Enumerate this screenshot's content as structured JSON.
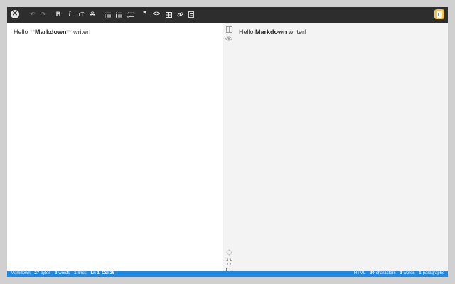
{
  "toolbar": {
    "buttons": [
      {
        "id": "undo",
        "glyph": "↶",
        "icon": "undo-icon",
        "enabled": false
      },
      {
        "id": "redo",
        "glyph": "↷",
        "icon": "redo-icon",
        "enabled": false
      },
      {
        "id": "bold",
        "glyph": "B",
        "icon": "bold-icon",
        "enabled": true
      },
      {
        "id": "italic",
        "glyph": "I",
        "icon": "italic-icon",
        "enabled": true
      },
      {
        "id": "heading",
        "glyph": "ᴛT",
        "icon": "heading-icon",
        "enabled": true
      },
      {
        "id": "strikethrough",
        "glyph": "S",
        "icon": "strikethrough-icon",
        "enabled": true
      },
      {
        "id": "bullet-list",
        "glyph": "",
        "icon": "bullet-list-icon",
        "enabled": true
      },
      {
        "id": "numbered-list",
        "glyph": "",
        "icon": "numbered-list-icon",
        "enabled": true
      },
      {
        "id": "task-list",
        "glyph": "",
        "icon": "task-list-icon",
        "enabled": true
      },
      {
        "id": "quote",
        "glyph": "❞",
        "icon": "quote-icon",
        "enabled": true
      },
      {
        "id": "code",
        "glyph": "<>",
        "icon": "code-icon",
        "enabled": true
      },
      {
        "id": "table",
        "glyph": "",
        "icon": "table-icon",
        "enabled": true
      },
      {
        "id": "link",
        "glyph": "",
        "icon": "link-icon",
        "enabled": true
      },
      {
        "id": "image",
        "glyph": "",
        "icon": "image-icon",
        "enabled": true
      }
    ]
  },
  "editor": {
    "prefix": "Hello ",
    "mark_open": "**",
    "bold_text": "Markdown",
    "mark_close": "**",
    "suffix": " writer!"
  },
  "preview": {
    "prefix": "Hello ",
    "bold_text": "Markdown",
    "suffix": " writer!"
  },
  "status": {
    "left": {
      "mode": "Markdown",
      "bytes_count": "27",
      "bytes_label": "bytes",
      "words_count": "3",
      "words_label": "words",
      "lines_count": "1",
      "lines_label": "lines",
      "cursor": "Ln 1, Col 26"
    },
    "right": {
      "mode": "HTML",
      "chars_count": "20",
      "chars_label": "characters",
      "words_count": "3",
      "words_label": "words",
      "paragraphs_count": "1",
      "paragraphs_label": "paragraphs"
    }
  },
  "colors": {
    "toolbar_bg": "#2d2d2d",
    "status_bg": "#1e88e5",
    "preview_bg": "#f3f3f3"
  }
}
